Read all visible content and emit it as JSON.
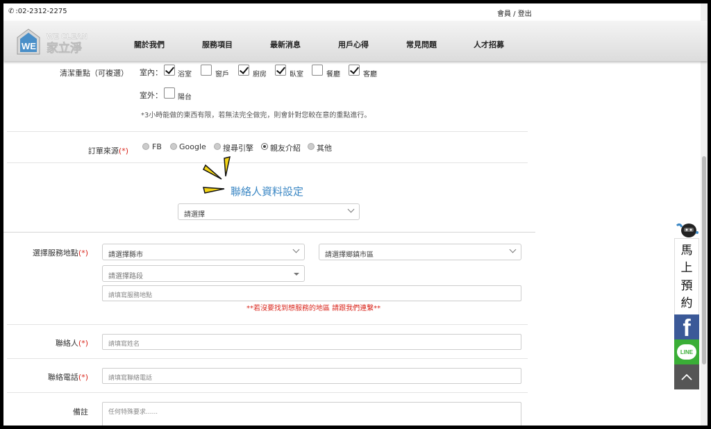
{
  "topbar": {
    "phone": ":02-2312-2275",
    "member": "會員 / 登出"
  },
  "brand": {
    "logo_letters": "WE",
    "logo_en": "WE CLEAN",
    "logo_zh": "家立淨"
  },
  "nav": [
    "關於我們",
    "服務項目",
    "最新消息",
    "用戶心得",
    "常見問題",
    "人才招募"
  ],
  "cleaning": {
    "label": "清潔重點（可複選）",
    "indoor_label": "室內：",
    "indoor_options": [
      {
        "label": "浴室",
        "checked": true
      },
      {
        "label": "窗戶",
        "checked": false
      },
      {
        "label": "廚房",
        "checked": true
      },
      {
        "label": "臥室",
        "checked": true
      },
      {
        "label": "餐廳",
        "checked": false
      },
      {
        "label": "客廳",
        "checked": true
      }
    ],
    "outdoor_label": "室外：",
    "outdoor_options": [
      {
        "label": "陽台",
        "checked": false
      }
    ],
    "note": "*3小時能做的東西有限，若無法完全做完，則會針對您較在意的重點進行。"
  },
  "source": {
    "label": "訂單來源",
    "required_mark": "(*)",
    "options": [
      {
        "label": "FB",
        "checked": false
      },
      {
        "label": "Google",
        "checked": false
      },
      {
        "label": "搜尋引擎",
        "checked": false
      },
      {
        "label": "親友介紹",
        "checked": true
      },
      {
        "label": "其他",
        "checked": false
      }
    ]
  },
  "contact": {
    "title": "聯絡人資料設定",
    "preset_select": "請選擇"
  },
  "location": {
    "label": "選擇服務地點",
    "required_mark": "(*)",
    "city_select": "請選擇縣市",
    "district_select": "請選擇鄉鎮市區",
    "road_select": "請選擇路段",
    "address_placeholder": "請填寫服務地點",
    "notice": "**若沒要找到想服務的地區 請跟我們連繫**"
  },
  "name": {
    "label": "聯絡人",
    "required_mark": "(*)",
    "placeholder": "請填寫姓名"
  },
  "phone": {
    "label": "聯絡電話",
    "required_mark": "(*)",
    "placeholder": "請填寫聯絡電話"
  },
  "remark": {
    "label": "備註",
    "placeholder": "任何特殊要求......"
  },
  "float": {
    "booking_chars": [
      "馬",
      "上",
      "預",
      "約"
    ],
    "fb_letter": "f",
    "line_text": "LINE"
  },
  "colors": {
    "accent": "#3b87c4",
    "required": "#d9261c",
    "facebook": "#3b5998",
    "line": "#3aae36"
  }
}
